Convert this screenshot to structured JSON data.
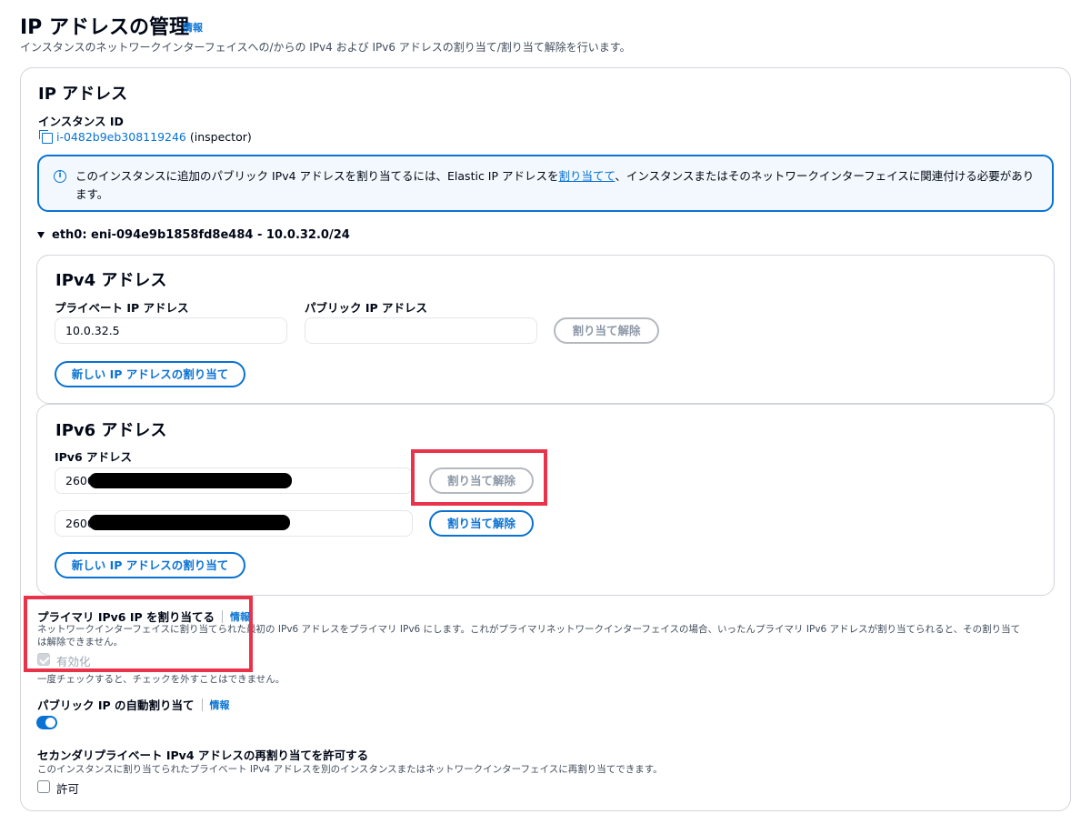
{
  "header": {
    "title": "IP アドレスの管理",
    "info": "情報",
    "description": "インスタンスのネットワークインターフェイスへの/からの IPv4 および IPv6 アドレスの割り当て/割り当て解除を行います。"
  },
  "ip_section": {
    "title": "IP アドレス",
    "instance_id_label": "インスタンス ID",
    "instance_id": "i-0482b9eb308119246",
    "instance_name": "(inspector)"
  },
  "alert": {
    "text_before": "このインスタンスに追加のパブリック IPv4 アドレスを割り当てるには、Elastic IP アドレスを",
    "link": "割り当てて",
    "text_after": "、インスタンスまたはそのネットワークインターフェイスに関連付ける必要があります。"
  },
  "eni": {
    "label": "eth0: eni-094e9b1858fd8e484 - 10.0.32.0/24"
  },
  "ipv4": {
    "title": "IPv4 アドレス",
    "private_label": "プライベート IP アドレス",
    "public_label": "パブリック IP アドレス",
    "private_value": "10.0.32.5",
    "public_value": "",
    "unassign_label": "割り当て解除",
    "assign_new_label": "新しい IP アドレスの割り当て"
  },
  "ipv6": {
    "title": "IPv6 アドレス",
    "address_label": "IPv6 アドレス",
    "addresses": [
      {
        "value": "2600",
        "unassign_label": "割り当て解除"
      },
      {
        "value": "2600",
        "unassign_label": "割り当て解除"
      }
    ],
    "assign_new_label": "新しい IP アドレスの割り当て"
  },
  "primary_ipv6": {
    "label": "プライマリ IPv6 IP を割り当てる",
    "info": "情報",
    "description_line1": "ネットワークインターフェイスに割り当てられた最初の IPv6 アドレスをプライマリ IPv6 にします。これがプライマリネットワークインターフェイスの場合、いったんプライマリ IPv6 アドレスが割り当てられると、その割り当て",
    "description_line2": "は解除できません。",
    "checkbox_label": "有効化",
    "hint": "一度チェックすると、チェックを外すことはできません。"
  },
  "public_ip_auto": {
    "label": "パブリック IP の自動割り当て",
    "info": "情報",
    "enabled": true
  },
  "secondary_reassign": {
    "label": "セカンダリプライベート IPv4 アドレスの再割り当てを許可する",
    "description": "このインスタンスに割り当てられたプライベート IPv4 アドレスを別のインスタンスまたはネットワークインターフェイスに再割り当てできます。",
    "checkbox_label": "許可"
  },
  "colors": {
    "accent": "#0972d3",
    "highlight": "#e8334a",
    "disabled": "#8d99a8"
  }
}
